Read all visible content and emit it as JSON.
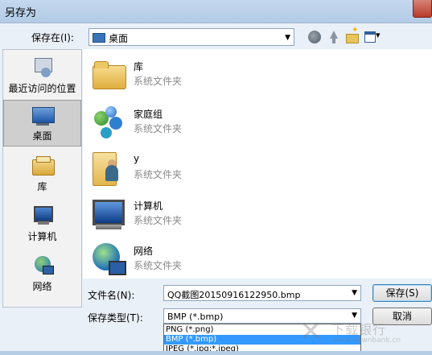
{
  "window": {
    "title": "另存为"
  },
  "toolbar": {
    "save_in_label": "保存在(I):",
    "location": "桌面"
  },
  "sidebar": {
    "items": [
      {
        "label": "最近访问的位置",
        "icon": "recent-places-icon"
      },
      {
        "label": "桌面",
        "icon": "desktop-icon",
        "selected": true
      },
      {
        "label": "库",
        "icon": "library-icon"
      },
      {
        "label": "计算机",
        "icon": "computer-icon"
      },
      {
        "label": "网络",
        "icon": "network-icon"
      }
    ]
  },
  "files": [
    {
      "name": "库",
      "type": "系统文件夹",
      "icon": "library-folder-icon"
    },
    {
      "name": "家庭组",
      "type": "系统文件夹",
      "icon": "homegroup-icon"
    },
    {
      "name": "y",
      "type": "系统文件夹",
      "icon": "user-folder-icon"
    },
    {
      "name": "计算机",
      "type": "系统文件夹",
      "icon": "computer-icon"
    },
    {
      "name": "网络",
      "type": "系统文件夹",
      "icon": "network-icon"
    }
  ],
  "form": {
    "filename_label": "文件名(N):",
    "filename_value": "QQ截图20150916122950.bmp",
    "type_label": "保存类型(T):",
    "type_value": "BMP (*.bmp)",
    "type_options": [
      "PNG (*.png)",
      "BMP (*.bmp)",
      "JPEG (*.jpg;*.jpeg)"
    ],
    "save_button": "保存(S)",
    "cancel_button": "取消"
  },
  "watermark": {
    "text": "下载银行",
    "sub": "www.downbank.cn"
  },
  "colors": {
    "selection": "#3399ff",
    "window_frame": "#c4d8ee",
    "close_button": "#c44a38"
  }
}
